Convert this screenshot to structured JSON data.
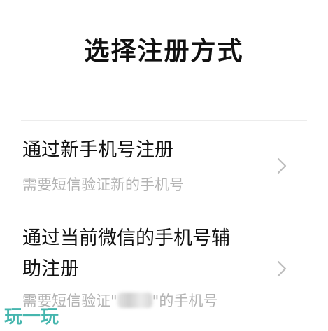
{
  "page": {
    "title": "选择注册方式"
  },
  "options": [
    {
      "title": "通过新手机号注册",
      "description": "需要短信验证新的手机号"
    },
    {
      "title_line1": "通过当前微信的手机号辅",
      "title_line2": "助注册",
      "description_prefix": "需要短信验证\"",
      "description_suffix": "\"的手机号"
    }
  ],
  "icons": {
    "chevron": "chevron-right-icon"
  },
  "watermark": {
    "text": "玩一玩"
  },
  "colors": {
    "primary_text": "#111111",
    "secondary_text": "#b3b3b3",
    "divider": "#ececec",
    "watermark": "#26a9a0"
  }
}
